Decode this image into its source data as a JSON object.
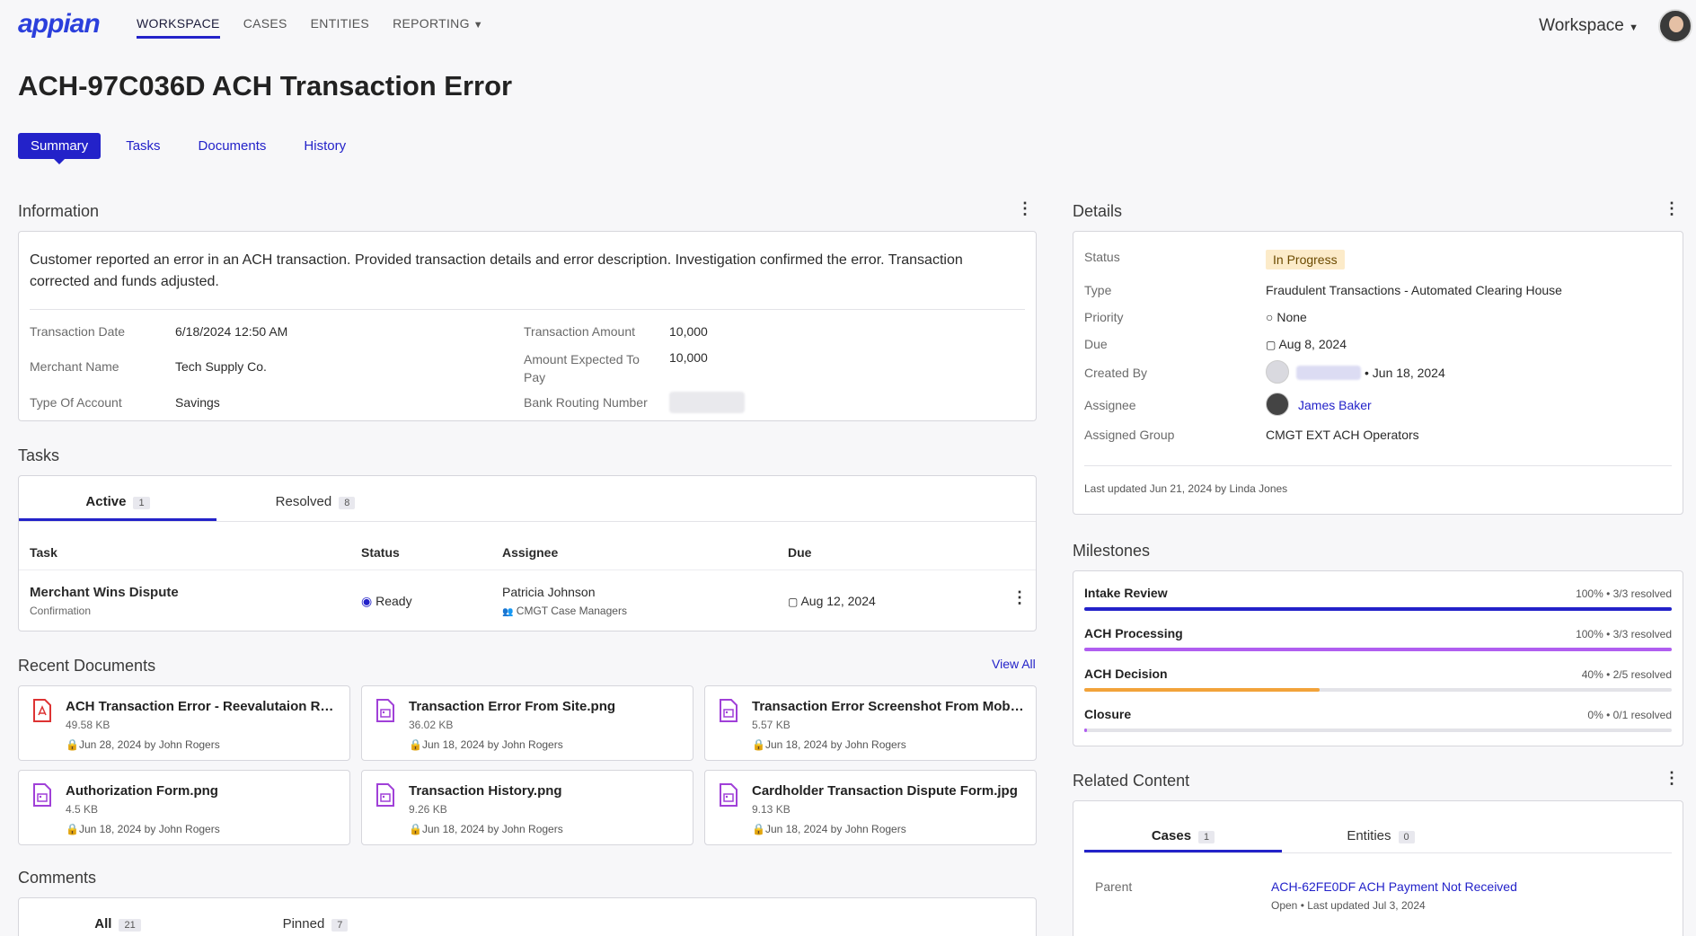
{
  "nav": {
    "logo": "appian",
    "items": [
      {
        "label": "WORKSPACE"
      },
      {
        "label": "CASES"
      },
      {
        "label": "ENTITIES"
      },
      {
        "label": "REPORTING"
      }
    ],
    "workspace_menu": "Workspace"
  },
  "page": {
    "title": "ACH-97C036D ACH Transaction Error",
    "tabs": [
      "Summary",
      "Tasks",
      "Documents",
      "History"
    ]
  },
  "information": {
    "title": "Information",
    "description": "Customer reported an error in an ACH transaction. Provided transaction details and error description. Investigation confirmed the error. Transaction corrected and funds adjusted.",
    "fields_left": [
      {
        "label": "Transaction Date",
        "value": "6/18/2024 12:50 AM"
      },
      {
        "label": "Merchant Name",
        "value": "Tech Supply Co."
      },
      {
        "label": "Type Of Account",
        "value": "Savings"
      }
    ],
    "fields_right": [
      {
        "label": "Transaction Amount",
        "value": "10,000"
      },
      {
        "label": "Amount Expected To Pay",
        "value": "10,000"
      },
      {
        "label": "Bank Routing Number",
        "value": ""
      }
    ]
  },
  "tasks": {
    "title": "Tasks",
    "tabs": [
      {
        "label": "Active",
        "count": "1"
      },
      {
        "label": "Resolved",
        "count": "8"
      }
    ],
    "columns": [
      "Task",
      "Status",
      "Assignee",
      "Due"
    ],
    "rows": [
      {
        "task": "Merchant Wins Dispute",
        "sub": "Confirmation",
        "status": "Ready",
        "assignee": "Patricia Johnson",
        "group": "CMGT Case Managers",
        "due": "Aug 12, 2024"
      }
    ]
  },
  "documents": {
    "title": "Recent Documents",
    "view_all": "View All",
    "items": [
      {
        "name": "ACH Transaction Error - Reevalutaion Rep...",
        "size": "49.58 KB",
        "meta": "Jun 28, 2024 by John Rogers",
        "type": "pdf"
      },
      {
        "name": "Transaction Error From Site.png",
        "size": "36.02 KB",
        "meta": "Jun 18, 2024 by John Rogers",
        "type": "image"
      },
      {
        "name": "Transaction Error Screenshot From Mobil...",
        "size": "5.57 KB",
        "meta": "Jun 18, 2024 by John Rogers",
        "type": "image"
      },
      {
        "name": "Authorization Form.png",
        "size": "4.5 KB",
        "meta": "Jun 18, 2024 by John Rogers",
        "type": "image"
      },
      {
        "name": "Transaction History.png",
        "size": "9.26 KB",
        "meta": "Jun 18, 2024 by John Rogers",
        "type": "image"
      },
      {
        "name": "Cardholder Transaction Dispute Form.jpg",
        "size": "9.13 KB",
        "meta": "Jun 18, 2024 by John Rogers",
        "type": "image"
      }
    ]
  },
  "comments": {
    "title": "Comments",
    "tabs": [
      {
        "label": "All",
        "count": "21"
      },
      {
        "label": "Pinned",
        "count": "7"
      }
    ]
  },
  "details": {
    "title": "Details",
    "status_label": "Status",
    "status": "In Progress",
    "type_label": "Type",
    "type": "Fraudulent Transactions - Automated Clearing House",
    "priority_label": "Priority",
    "priority": "None",
    "due_label": "Due",
    "due": "Aug 8, 2024",
    "created_label": "Created By",
    "created_date": "Jun 18, 2024",
    "assignee_label": "Assignee",
    "assignee": "James Baker",
    "group_label": "Assigned Group",
    "group": "CMGT EXT ACH Operators",
    "last_updated": "Last updated Jun 21, 2024 by Linda Jones",
    "status_bg": "#fcebc9"
  },
  "milestones": {
    "title": "Milestones",
    "items": [
      {
        "name": "Intake Review",
        "meta": "100% • 3/3 resolved",
        "progress": 1.0,
        "color": "#2322c9"
      },
      {
        "name": "ACH Processing",
        "meta": "100% • 3/3 resolved",
        "progress": 1.0,
        "color": "#b05ef0"
      },
      {
        "name": "ACH Decision",
        "meta": "40% • 2/5 resolved",
        "progress": 0.4,
        "color": "#f2a33a"
      },
      {
        "name": "Closure",
        "meta": "0% • 0/1 resolved",
        "progress": 0.0,
        "color": "#b05ef0"
      }
    ]
  },
  "related": {
    "title": "Related Content",
    "tabs": [
      {
        "label": "Cases",
        "count": "1"
      },
      {
        "label": "Entities",
        "count": "0"
      }
    ],
    "parent_label": "Parent",
    "parent_link": "ACH-62FE0DF ACH Payment Not Received",
    "parent_meta": "Open • Last updated Jul 3, 2024"
  }
}
